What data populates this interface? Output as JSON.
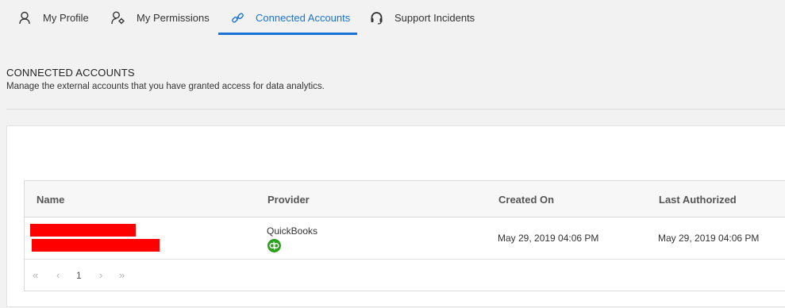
{
  "tabs": [
    {
      "label": "My Profile",
      "icon": "user-icon"
    },
    {
      "label": "My Permissions",
      "icon": "user-gear-icon"
    },
    {
      "label": "Connected Accounts",
      "icon": "link-icon",
      "active": true
    },
    {
      "label": "Support Incidents",
      "icon": "headset-icon"
    }
  ],
  "page": {
    "title": "CONNECTED ACCOUNTS",
    "subtitle": "Manage the external accounts that you have granted access for data analytics."
  },
  "table": {
    "headers": [
      "Name",
      "Provider",
      "Created On",
      "Last Authorized"
    ],
    "rows": [
      {
        "name": "",
        "provider": "QuickBooks",
        "provider_icon": "quickbooks-icon",
        "created_on": "May 29, 2019 04:06 PM",
        "last_authorized": "May 29, 2019 04:06 PM"
      }
    ]
  },
  "pager": {
    "current_page": "1",
    "first": "«",
    "prev": "‹",
    "next": "›",
    "last": "»"
  },
  "colors": {
    "accent": "#1a73d6",
    "redaction": "#ff0000",
    "quickbooks": "#2ca01c"
  }
}
